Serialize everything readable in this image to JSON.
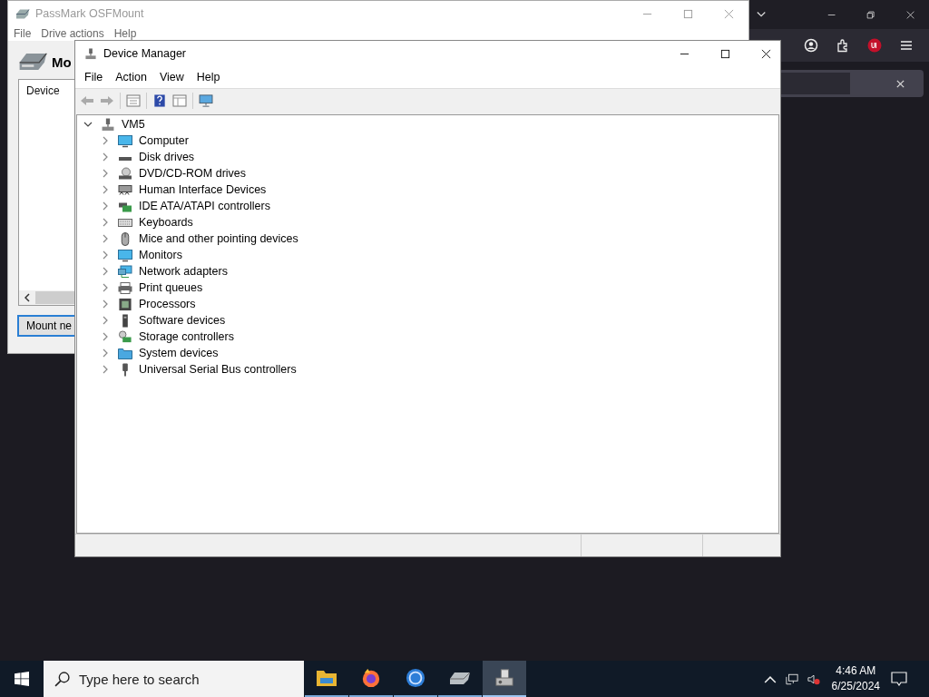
{
  "osfmount": {
    "title": "PassMark OSFMount",
    "menu": [
      "File",
      "Drive actions",
      "Help"
    ],
    "heading": "Mo",
    "list": {
      "columns": [
        "Device"
      ]
    },
    "button": "Mount ne"
  },
  "device_manager": {
    "title": "Device Manager",
    "menu": [
      "File",
      "Action",
      "View",
      "Help"
    ],
    "tree": {
      "label": "VM5",
      "expanded": true,
      "children": [
        {
          "label": "Computer",
          "expanded": false
        },
        {
          "label": "Disk drives",
          "expanded": false
        },
        {
          "label": "DVD/CD-ROM drives",
          "expanded": false
        },
        {
          "label": "Human Interface Devices",
          "expanded": false
        },
        {
          "label": "IDE ATA/ATAPI controllers",
          "expanded": false
        },
        {
          "label": "Keyboards",
          "expanded": false
        },
        {
          "label": "Mice and other pointing devices",
          "expanded": false
        },
        {
          "label": "Monitors",
          "expanded": false
        },
        {
          "label": "Network adapters",
          "expanded": false
        },
        {
          "label": "Print queues",
          "expanded": false
        },
        {
          "label": "Processors",
          "expanded": false
        },
        {
          "label": "Software devices",
          "expanded": false
        },
        {
          "label": "Storage controllers",
          "expanded": false
        },
        {
          "label": "System devices",
          "expanded": false
        },
        {
          "label": "Universal Serial Bus controllers",
          "expanded": false
        }
      ]
    }
  },
  "taskbar": {
    "search": {
      "placeholder": "Type here to search"
    },
    "apps": [
      {
        "selected": false
      },
      {
        "selected": false
      },
      {
        "selected": false
      },
      {
        "selected": false
      },
      {
        "selected": true
      }
    ],
    "clock": {
      "time": "4:46 AM",
      "date": "6/25/2024"
    }
  }
}
